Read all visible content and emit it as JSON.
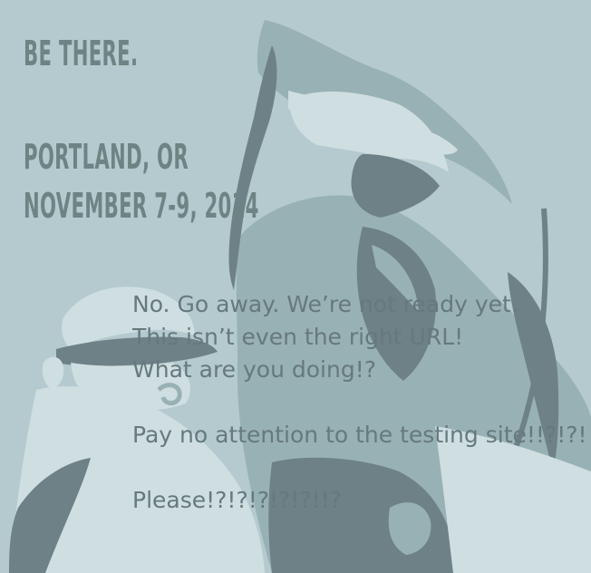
{
  "event": {
    "tagline": "Be There.",
    "location": "Portland, Or",
    "dates": "November 7-9, 2014"
  },
  "message": {
    "line1": "No.  Go away.  We’re not ready yet.",
    "line2": "This isn’t even the right URL!",
    "line3": "What are you doing!?",
    "line4": "Pay no attention to the testing site!!?!?!",
    "line5": "Please!?!?!?!?!?!!?"
  },
  "colors": {
    "background": "#b4cace",
    "dark_figure": "#6d8186",
    "mid_figure": "#98b1b4",
    "light_figure": "#cfdee1",
    "event_text": "#6e8484",
    "message_text": "#66797c"
  }
}
